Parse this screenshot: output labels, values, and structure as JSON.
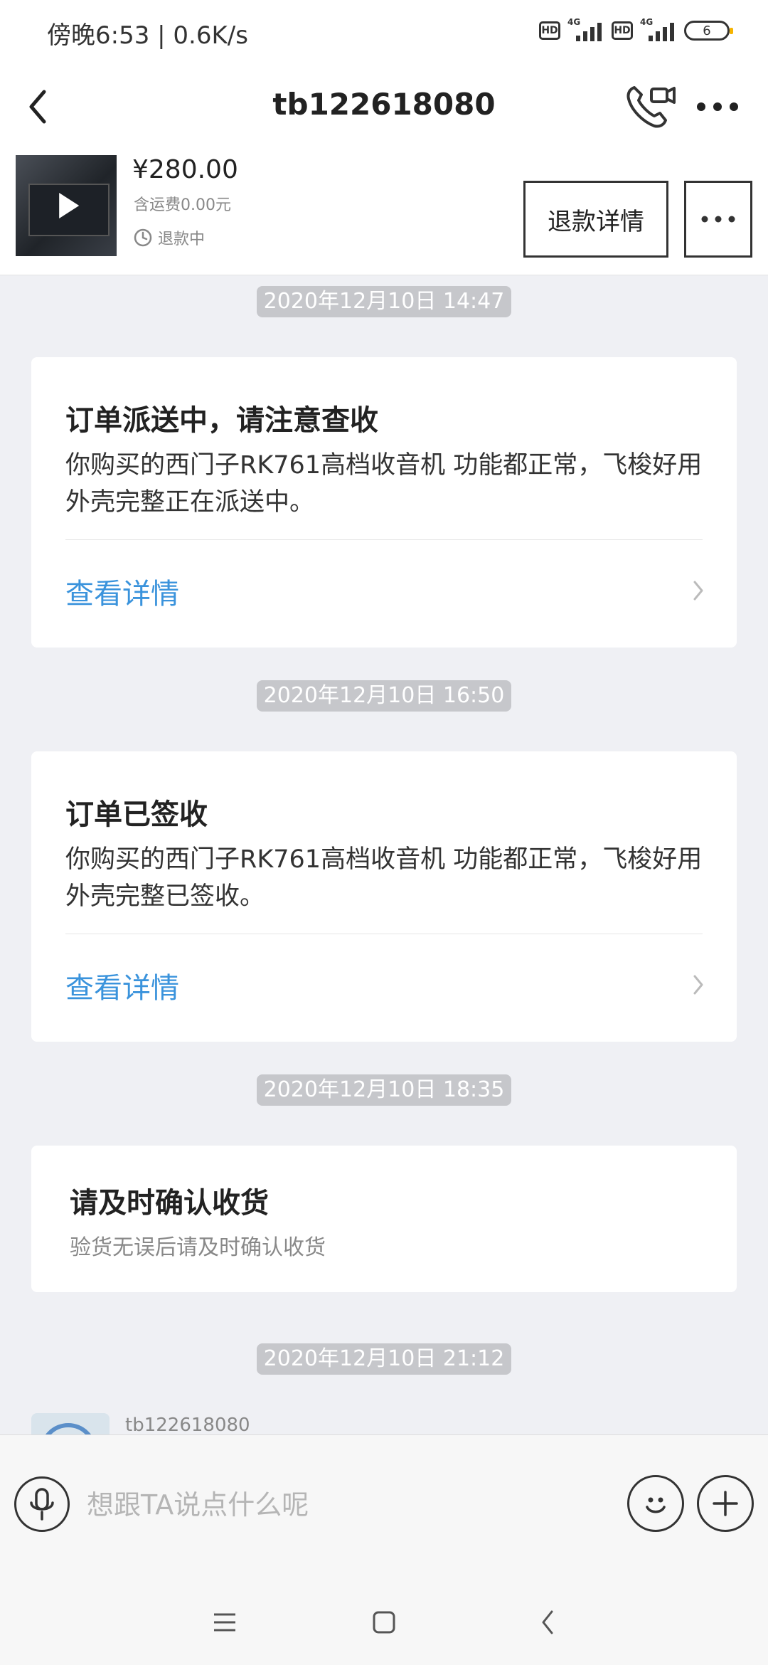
{
  "status_bar": {
    "time": "傍晚6:53 | 0.6K/s",
    "hd1": "HD",
    "hd2": "HD",
    "net1": "4G",
    "net2": "4G",
    "battery": "6"
  },
  "nav": {
    "title": "tb122618080",
    "icons": {
      "back": "chevron-left-icon",
      "call": "phone-video-icon",
      "more": "more-dots-icon"
    }
  },
  "product": {
    "price": "¥280.00",
    "shipping": "含运费0.00元",
    "status": "退款中",
    "refund_button": "退款详情"
  },
  "messages": [
    {
      "time": "2020年12月10日 14:47",
      "title": "订单派送中，请注意查收",
      "body": "你购买的西门子RK761高档收音机 功能都正常，飞梭好用 外壳完整正在派送中。",
      "link": "查看详情"
    },
    {
      "time": "2020年12月10日 16:50",
      "title": "订单已签收",
      "body": "你购买的西门子RK761高档收音机 功能都正常，飞梭好用 外壳完整已签收。",
      "link": "查看详情"
    },
    {
      "time": "2020年12月10日 18:35",
      "title": "请及时确认收货",
      "subtitle": "验货无误后请及时确认收货"
    },
    {
      "time": "2020年12月10日 21:12",
      "sender": "tb122618080"
    }
  ],
  "input": {
    "placeholder": "想跟TA说点什么呢",
    "value": ""
  },
  "colors": {
    "link": "#3a93dc",
    "background": "#eff0f4",
    "pill": "#c6c7cb"
  }
}
